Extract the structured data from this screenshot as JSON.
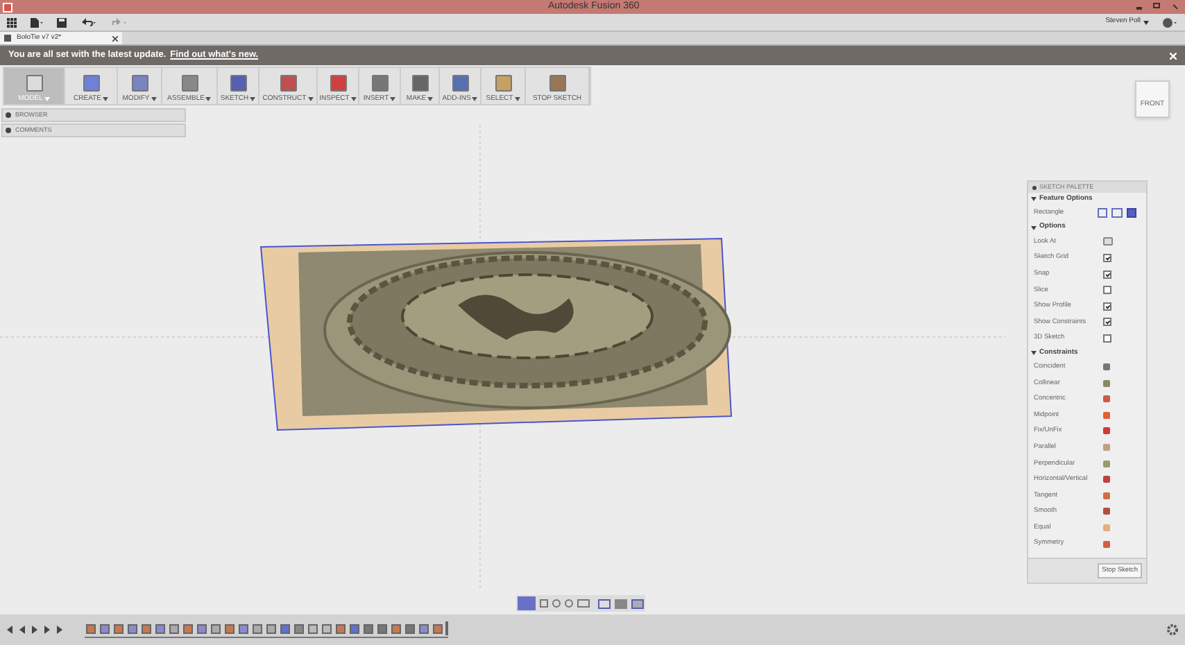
{
  "window": {
    "title": "Autodesk Fusion 360"
  },
  "quick_access": {
    "user": "Steven Poll"
  },
  "tabs": [
    {
      "label": "BoloTie v7 v2*",
      "selected": true
    }
  ],
  "notification": {
    "text": "You are all set with the latest update.",
    "link": "Find out what's new."
  },
  "ribbon": [
    {
      "label": "MODEL",
      "has_menu": true,
      "selected": true
    },
    {
      "label": "CREATE",
      "has_menu": true,
      "selected": false
    },
    {
      "label": "MODIFY",
      "has_menu": true,
      "selected": false
    },
    {
      "label": "ASSEMBLE",
      "has_menu": true,
      "selected": false
    },
    {
      "label": "SKETCH",
      "has_menu": true,
      "selected": false
    },
    {
      "label": "CONSTRUCT",
      "has_menu": true,
      "selected": false
    },
    {
      "label": "INSPECT",
      "has_menu": true,
      "selected": false
    },
    {
      "label": "INSERT",
      "has_menu": true,
      "selected": false
    },
    {
      "label": "MAKE",
      "has_menu": true,
      "selected": false
    },
    {
      "label": "ADD-INS",
      "has_menu": true,
      "selected": false
    },
    {
      "label": "SELECT",
      "has_menu": true,
      "selected": false
    },
    {
      "label": "STOP SKETCH",
      "has_menu": false,
      "selected": false
    }
  ],
  "browser_panels": [
    "BROWSER",
    "COMMENTS"
  ],
  "viewcube": {
    "face": "FRONT"
  },
  "sketch_palette": {
    "title": "SKETCH PALETTE",
    "sections": [
      {
        "title": "Feature Options",
        "expanded": true,
        "rows": [
          {
            "kind": "shapes",
            "label": "Rectangle",
            "options": [
              {
                "selected": false
              },
              {
                "selected": false
              },
              {
                "selected": true
              }
            ]
          }
        ]
      },
      {
        "title": "Options",
        "expanded": true,
        "rows": [
          {
            "kind": "button",
            "label": "Look At"
          },
          {
            "kind": "check",
            "label": "Sketch Grid",
            "checked": true
          },
          {
            "kind": "check",
            "label": "Snap",
            "checked": true
          },
          {
            "kind": "check",
            "label": "Slice",
            "checked": false
          },
          {
            "kind": "check",
            "label": "Show Profile",
            "checked": true
          },
          {
            "kind": "check",
            "label": "Show Constraints",
            "checked": true
          },
          {
            "kind": "check",
            "label": "3D Sketch",
            "checked": false
          }
        ]
      },
      {
        "title": "Constraints",
        "expanded": true,
        "rows": [
          {
            "kind": "constraint",
            "label": "Coincident",
            "color": "#777777"
          },
          {
            "kind": "constraint",
            "label": "Collinear",
            "color": "#8a8a60"
          },
          {
            "kind": "constraint",
            "label": "Concentric",
            "color": "#d05a40"
          },
          {
            "kind": "constraint",
            "label": "Midpoint",
            "color": "#e06030"
          },
          {
            "kind": "constraint",
            "label": "Fix/UnFix",
            "color": "#d03a3a"
          },
          {
            "kind": "constraint",
            "label": "Parallel",
            "color": "#c0a080"
          },
          {
            "kind": "constraint",
            "label": "Perpendicular",
            "color": "#9a9a70"
          },
          {
            "kind": "constraint",
            "label": "Horizontal/Vertical",
            "color": "#c04040"
          },
          {
            "kind": "constraint",
            "label": "Tangent",
            "color": "#d07040"
          },
          {
            "kind": "constraint",
            "label": "Smooth",
            "color": "#b05040"
          },
          {
            "kind": "constraint",
            "label": "Equal",
            "color": "#e0b080"
          },
          {
            "kind": "constraint",
            "label": "Symmetry",
            "color": "#d06040"
          }
        ]
      }
    ],
    "button": "Stop Sketch"
  }
}
